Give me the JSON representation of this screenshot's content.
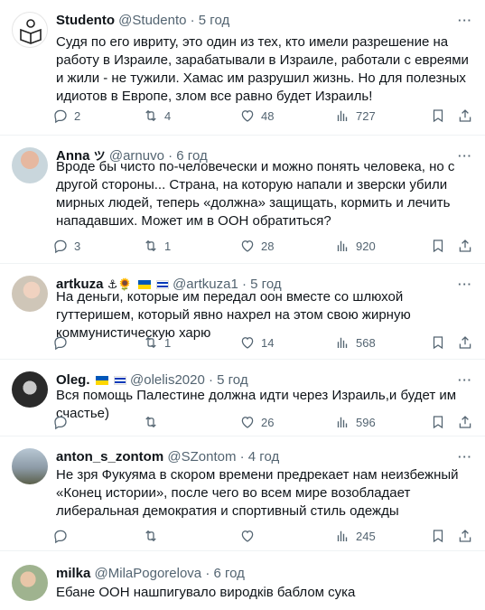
{
  "tweets": [
    {
      "name": "Studento",
      "handle": "@Studento",
      "time": "5 год",
      "text": "Судя по его ивриту, это один из тех, кто имели разрешение на работу в Израиле, зарабатывали в Израиле, работали с евреями и жили - не тужили. Хамас им разрушил жизнь. Но для полезных идиотов в Европе, злом все равно будет Израиль!",
      "replies": "2",
      "retweets": "4",
      "likes": "48",
      "views": "727"
    },
    {
      "name": "Anna",
      "name_badge": "ツ",
      "handle": "@arnuvo",
      "time": "6 год",
      "text": "Вроде бы чисто по-человечески и можно понять человека, но с другой стороны... Страна, на которую напали и зверски убили мирных людей, теперь «должна» защищать, кормить и лечить нападавших. Может им в ООН обратиться?",
      "replies": "3",
      "retweets": "1",
      "likes": "28",
      "views": "920"
    },
    {
      "name": "artkuza",
      "name_badge": "⚓🌻",
      "handle": "@artkuza1",
      "time": "5 год",
      "text": "На деньги, которые им передал оон вместе со шлюхой гуттеришем, который явно нахрел на этом свою жирную коммунистическую харю",
      "replies": "",
      "retweets": "1",
      "likes": "14",
      "views": "568"
    },
    {
      "name": "Oleg.",
      "handle": "@olelis2020",
      "time": "5 год",
      "text": "Вся помощь Палестине должна идти через Израиль,и будет им счастье)",
      "replies": "",
      "retweets": "",
      "likes": "26",
      "views": "596"
    },
    {
      "name": "anton_s_zontom",
      "handle": "@SZontom",
      "time": "4 год",
      "text": "Не зря Фукуяма в скором времени предрекает нам неизбежный «Конец истории», после чего во всем мире возобладает либеральная демократия и спортивный стиль одежды",
      "replies": "",
      "retweets": "",
      "likes": "",
      "views": "245"
    },
    {
      "name": "milka",
      "handle": "@MilaPogorelova",
      "time": "6 год",
      "text": "Ебане ООН нашпигувало виродків баблом сука"
    }
  ],
  "separator": "·",
  "more_label": "···",
  "colors": {
    "text": "#0f1419",
    "muted": "#536471",
    "border": "#eff3f4"
  }
}
